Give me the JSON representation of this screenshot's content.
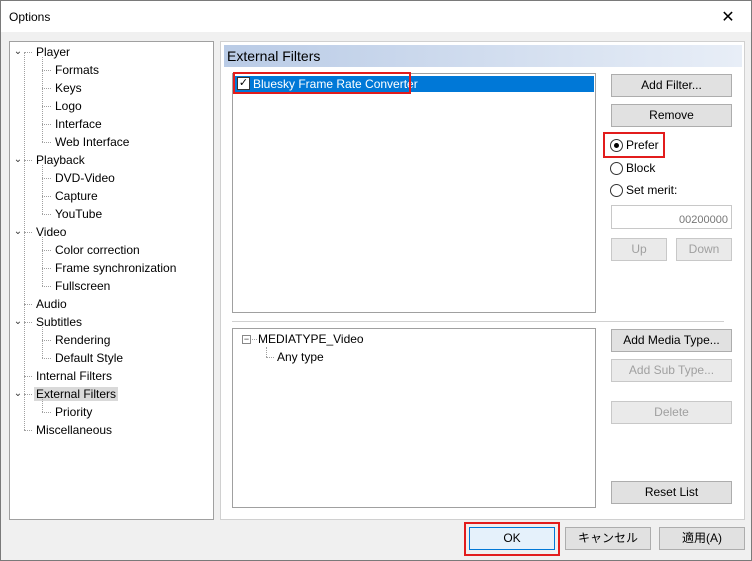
{
  "window": {
    "title": "Options",
    "close_glyph": "✕"
  },
  "tree": {
    "items": [
      {
        "label": "Player",
        "level": 0,
        "expanded": true
      },
      {
        "label": "Formats",
        "level": 1
      },
      {
        "label": "Keys",
        "level": 1
      },
      {
        "label": "Logo",
        "level": 1
      },
      {
        "label": "Interface",
        "level": 1
      },
      {
        "label": "Web Interface",
        "level": 1
      },
      {
        "label": "Playback",
        "level": 0,
        "expanded": true
      },
      {
        "label": "DVD-Video",
        "level": 1
      },
      {
        "label": "Capture",
        "level": 1
      },
      {
        "label": "YouTube",
        "level": 1
      },
      {
        "label": "Video",
        "level": 0,
        "expanded": true
      },
      {
        "label": "Color correction",
        "level": 1
      },
      {
        "label": "Frame synchronization",
        "level": 1
      },
      {
        "label": "Fullscreen",
        "level": 1
      },
      {
        "label": "Audio",
        "level": 0
      },
      {
        "label": "Subtitles",
        "level": 0,
        "expanded": true
      },
      {
        "label": "Rendering",
        "level": 1
      },
      {
        "label": "Default Style",
        "level": 1
      },
      {
        "label": "Internal Filters",
        "level": 0
      },
      {
        "label": "External Filters",
        "level": 0,
        "expanded": true,
        "selected": true
      },
      {
        "label": "Priority",
        "level": 1
      },
      {
        "label": "Miscellaneous",
        "level": 0
      }
    ]
  },
  "page": {
    "header": "External Filters",
    "filters": [
      {
        "label": "Bluesky Frame Rate Converter",
        "checked": true,
        "selected": true
      }
    ],
    "buttons": {
      "add_filter": "Add Filter...",
      "remove": "Remove",
      "up": "Up",
      "down": "Down",
      "add_media_type": "Add Media Type...",
      "add_sub_type": "Add Sub Type...",
      "delete": "Delete",
      "reset_list": "Reset List"
    },
    "merit": {
      "options": [
        "Prefer",
        "Block",
        "Set merit:"
      ],
      "selected": "Prefer",
      "value": "00200000"
    },
    "media_types": {
      "type": "MEDIATYPE_Video",
      "subtype": "Any type"
    }
  },
  "footer": {
    "ok": "OK",
    "cancel": "キャンセル",
    "apply": "適用(A)"
  },
  "colors": {
    "selection": "#0078d7",
    "highlight": "#e21c1c",
    "header_gradient_start": "#b9cbe6"
  },
  "icons": {
    "checkbox_check": "✓",
    "collapse_minus": "−",
    "chevron_down": "⌄"
  }
}
